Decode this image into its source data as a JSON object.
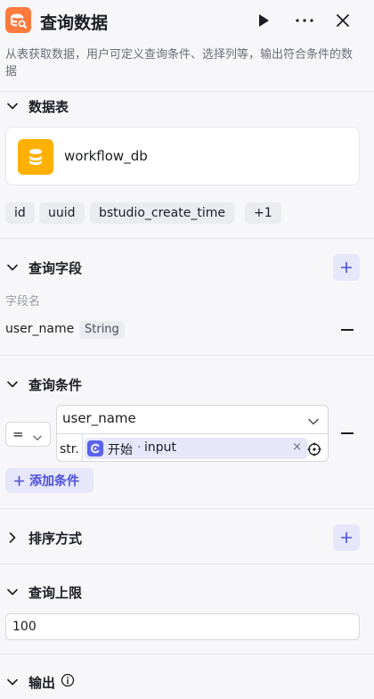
{
  "header": {
    "title": "查询数据",
    "app_icon": "database-query-icon",
    "actions": [
      "run-icon",
      "more-icon",
      "close-icon"
    ],
    "brand_color": "#ff7a3d"
  },
  "description": "从表获取数据，用户可定义查询条件、选择列等，输出符合条件的数据",
  "sections": {
    "table": {
      "label": "数据表",
      "db_name": "workflow_db",
      "db_icon": "database-icon",
      "columns": [
        "id",
        "uuid",
        "bstudio_create_time",
        "+1"
      ]
    },
    "fields": {
      "label": "查询字段",
      "caption": "字段名",
      "rows": [
        {
          "name": "user_name",
          "type": "String"
        }
      ]
    },
    "conditions": {
      "label": "查询条件",
      "operator": "=",
      "field": "user_name",
      "value_type": "str.",
      "ref_node": "开始",
      "ref_sep": "·",
      "ref_var": "input",
      "clear": "×",
      "add_label": "添加条件"
    },
    "sort": {
      "label": "排序方式"
    },
    "limit": {
      "label": "查询上限",
      "value": "100"
    },
    "output": {
      "label": "输出"
    }
  },
  "colors": {
    "accent": "#4a4fd8",
    "accent_bg": "#e6e7fb",
    "db_icon_bg": "#ffb000"
  }
}
